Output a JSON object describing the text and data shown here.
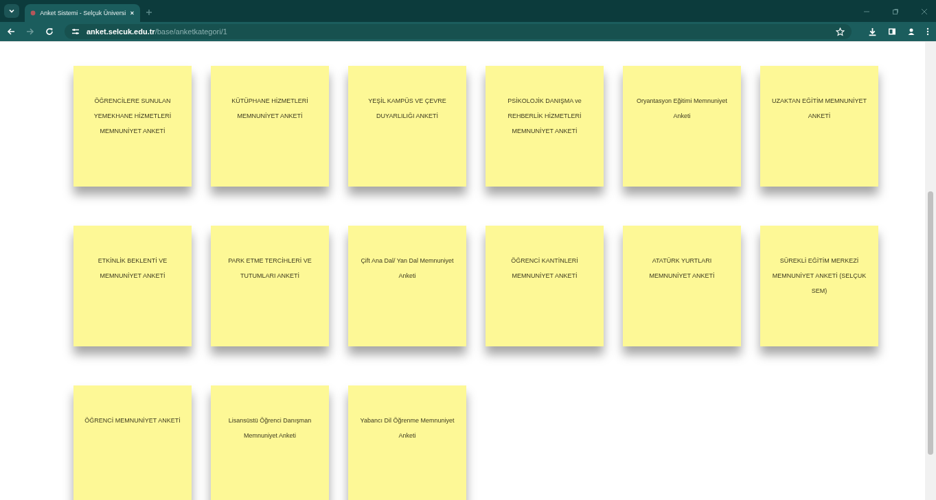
{
  "browser": {
    "tab_title": "Anket Sistemi - Selçuk Üniversi",
    "url_domain": "anket.selcuk.edu.tr",
    "url_path": "/base/anketkategori/1"
  },
  "cards": [
    {
      "title": "ÖĞRENCİLERE SUNULAN YEMEKHANE HİZMETLERİ MEMNUNİYET ANKETİ"
    },
    {
      "title": "KÜTÜPHANE HİZMETLERİ MEMNUNİYET ANKETİ"
    },
    {
      "title": "YEŞİL KAMPÜS VE ÇEVRE DUYARLILIĞI ANKETİ"
    },
    {
      "title": "PSİKOLOJİK DANIŞMA ve REHBERLİK HİZMETLERİ MEMNUNİYET ANKETİ"
    },
    {
      "title": "Oryantasyon Eğitimi Memnuniyet Anketi"
    },
    {
      "title": "UZAKTAN EĞİTİM MEMNUNİYET ANKETİ"
    },
    {
      "title": "ETKİNLİK BEKLENTİ VE MEMNUNİYET ANKETİ"
    },
    {
      "title": "PARK ETME TERCİHLERİ VE TUTUMLARI ANKETİ"
    },
    {
      "title": "Çift Ana Dal/ Yan Dal Memnuniyet Anketi"
    },
    {
      "title": "ÖĞRENCİ KANTİNLERİ MEMNUNİYET ANKETİ"
    },
    {
      "title": "ATATÜRK YURTLARI MEMNUNİYET ANKETİ"
    },
    {
      "title": "SÜREKLİ EĞİTİM MERKEZİ MEMNUNİYET ANKETİ (SELÇUK SEM)"
    },
    {
      "title": "ÖĞRENCİ MEMNUNİYET ANKETİ"
    },
    {
      "title": "Lisansüstü Öğrenci Danışman Memnuniyet Anketi"
    },
    {
      "title": "Yabancı Dil Öğrenme Memnuniyet Anketi"
    }
  ]
}
